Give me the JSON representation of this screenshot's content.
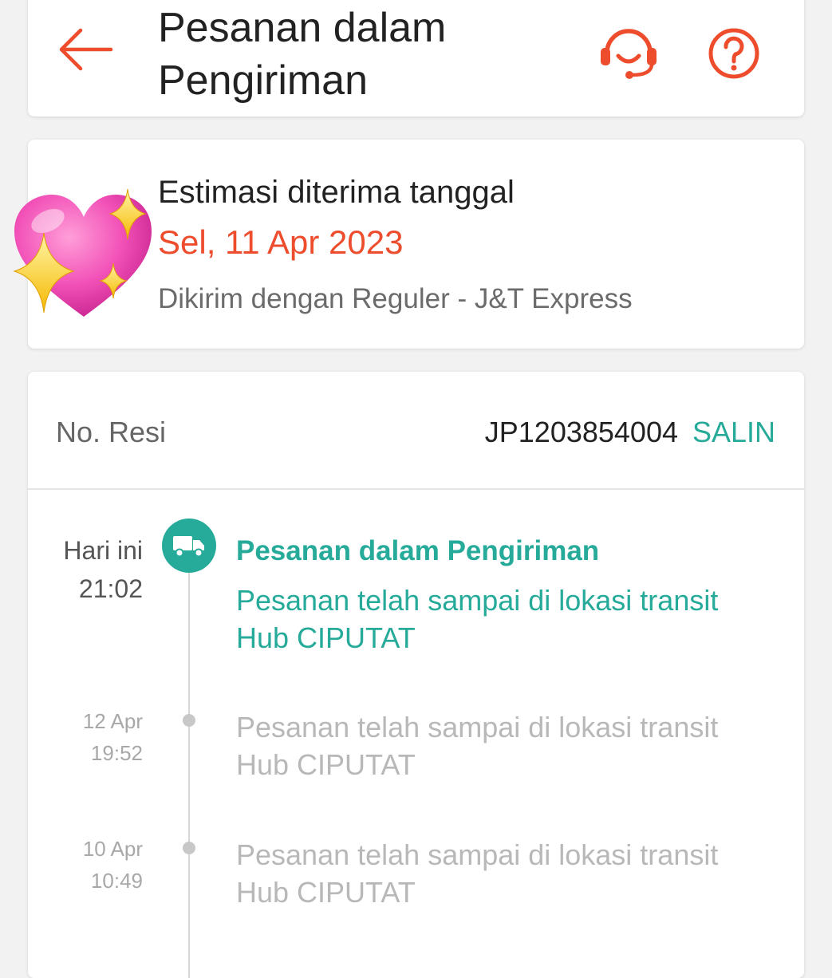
{
  "header": {
    "title": "Pesanan dalam Pengiriman",
    "back_icon": "arrow-left-icon",
    "support_icon": "headset-icon",
    "help_icon": "question-circle-icon"
  },
  "estimate": {
    "label": "Estimasi diterima tanggal",
    "date": "Sel, 11 Apr 2023",
    "courier": "Dikirim dengan Reguler - J&T Express",
    "sticker": "sparkling-heart-emoji"
  },
  "tracking": {
    "resi_label": "No. Resi",
    "resi_number": "JP1203854004",
    "copy_label": "SALIN",
    "events": [
      {
        "time_line1": "Hari ini",
        "time_line2": "21:02",
        "status": "Pesanan dalam Pengiriman",
        "description": "Pesanan telah sampai di lokasi transit Hub CIPUTAT",
        "icon": "truck-icon"
      },
      {
        "time_line1": "12 Apr",
        "time_line2": "19:52",
        "description": "Pesanan telah sampai di lokasi transit Hub CIPUTAT"
      },
      {
        "time_line1": "10 Apr",
        "time_line2": "10:49",
        "description": "Pesanan telah sampai di lokasi transit Hub CIPUTAT"
      }
    ]
  },
  "colors": {
    "brand": "#ee4d2d",
    "accent": "#26aa99",
    "text": "#222222",
    "muted": "#b8b8b8"
  }
}
